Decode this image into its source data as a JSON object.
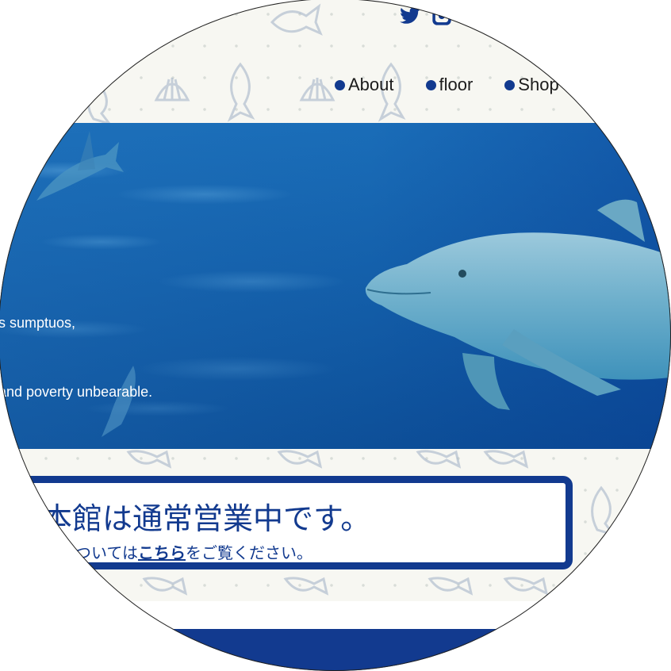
{
  "social": {
    "icons": [
      "twitter-icon",
      "instagram-icon",
      "facebook-icon"
    ]
  },
  "nav": {
    "items": [
      {
        "label": "About"
      },
      {
        "label": "floor"
      },
      {
        "label": "Shop"
      }
    ]
  },
  "hero": {
    "lines": [
      "s sumptuos,",
      "and poverty unbearable."
    ]
  },
  "notice": {
    "title": "本館は通常営業中です。",
    "sub_prefix": "ついては",
    "sub_link": "こちら",
    "sub_suffix": "をご覧ください。"
  },
  "colors": {
    "brand": "#123a8f",
    "background": "#f7f7f2",
    "hero_water": "#1460ab"
  }
}
